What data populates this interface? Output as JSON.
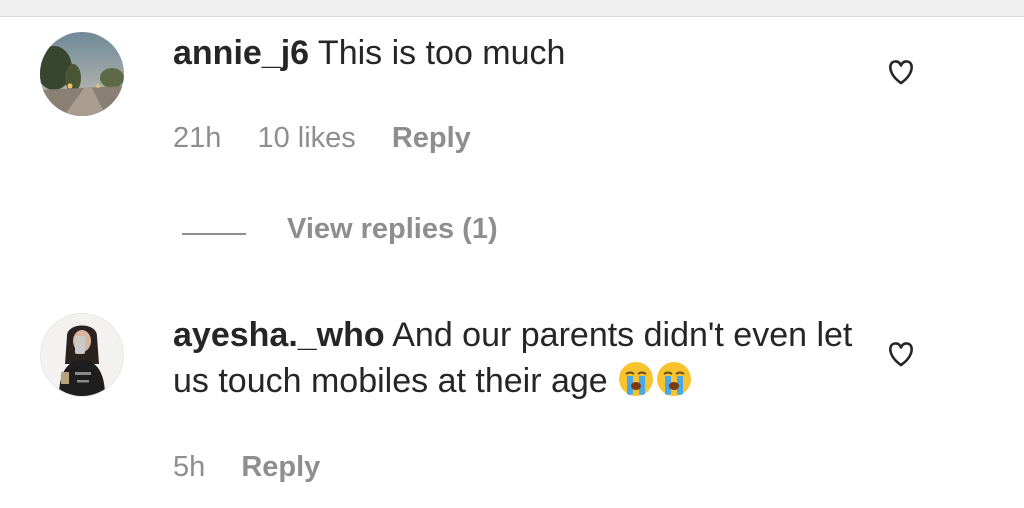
{
  "comments": [
    {
      "username": "annie_j6",
      "text": "This is too much",
      "time": "21h",
      "likes": "10 likes",
      "reply_label": "Reply",
      "view_replies_label": "View replies (1)"
    },
    {
      "username": "ayesha._who",
      "text": "And our parents didn't even let us touch mobiles at their age",
      "emoji": [
        "loudly-crying-face",
        "loudly-crying-face"
      ],
      "time": "5h",
      "reply_label": "Reply"
    }
  ],
  "icons": {
    "like": "heart-outline-icon"
  },
  "colors": {
    "text": "#262626",
    "meta": "#8e8e8e",
    "background": "#ffffff"
  }
}
